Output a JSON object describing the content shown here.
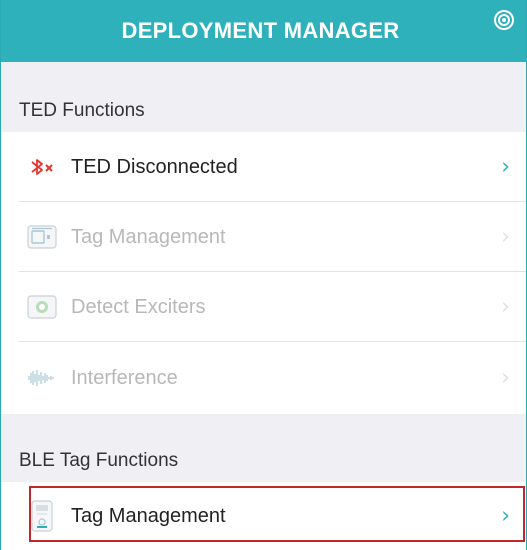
{
  "header": {
    "title": "DEPLOYMENT MANAGER",
    "settings_icon": "gear-icon"
  },
  "sections": {
    "ted": {
      "title": "TED Functions"
    },
    "ble": {
      "title": "BLE Tag Functions"
    }
  },
  "ted_items": [
    {
      "label": "TED Disconnected",
      "icon": "bluetooth-disconnected-icon",
      "enabled": true
    },
    {
      "label": "Tag Management",
      "icon": "tag-device-icon",
      "enabled": false
    },
    {
      "label": "Detect Exciters",
      "icon": "exciter-icon",
      "enabled": false
    },
    {
      "label": "Interference",
      "icon": "waveform-icon",
      "enabled": false
    }
  ],
  "ble_items": [
    {
      "label": "Tag Management",
      "icon": "ble-tag-icon",
      "enabled": true,
      "highlighted": true
    }
  ],
  "colors": {
    "accent": "#2fb1bc",
    "section_bg": "#efeff4",
    "disabled_text": "#b8b8b8",
    "highlight_border": "#c0272d",
    "bluetooth_red": "#e8352f"
  }
}
